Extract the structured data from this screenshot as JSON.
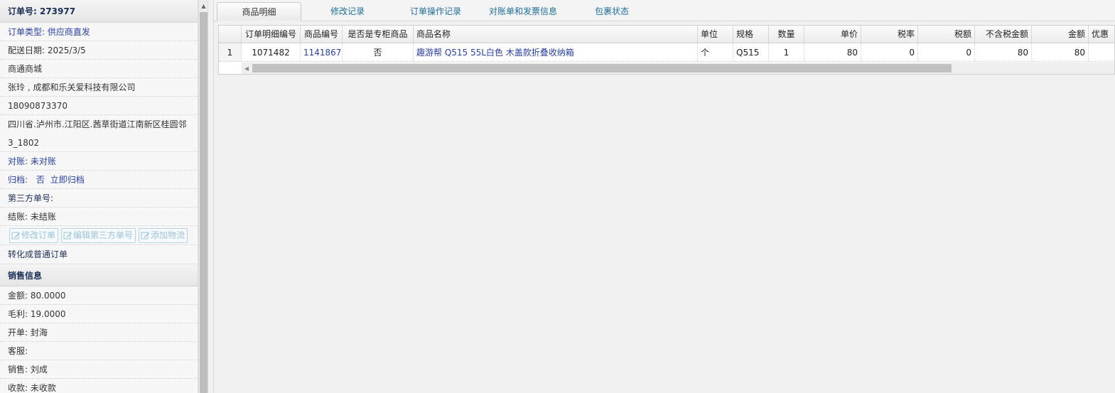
{
  "order": {
    "number_label": "订单号: 273977",
    "type": "订单类型: 供应商直发",
    "delivery_date": "配送日期: 2025/3/5",
    "store": "商通商城",
    "customer": "张玲 , 成都和乐关爱科技有限公司",
    "phone": "18090873370",
    "address_line1": "四川省.泸州市.江阳区.茜草街道江南新区桂圆邻",
    "address_line2": "3_1802",
    "reconciliation": "对账: 未对账",
    "archive_prefix": "归档:",
    "archive_status": "否",
    "archive_link": "立即归档",
    "third_party_no": "第三方单号:",
    "settlement": "结账: 未结账",
    "buttons": {
      "edit_order": "修改订单",
      "edit_third_party": "编辑第三方单号",
      "add_logistics": "添加物流"
    },
    "convert_link": "转化成普通订单"
  },
  "sales": {
    "title": "销售信息",
    "amount": "金额: 80.0000",
    "gross_profit": "毛利: 19.0000",
    "opened_by": "开单: 封海",
    "service": "客服:",
    "salesperson": "销售: 刘成",
    "payment": "收款: 未收款"
  },
  "tabs": [
    {
      "label": "商品明细",
      "active": true
    },
    {
      "label": "修改记录",
      "active": false
    },
    {
      "label": "订单操作记录",
      "active": false
    },
    {
      "label": "对账单和发票信息",
      "active": false
    },
    {
      "label": "包裹状态",
      "active": false
    }
  ],
  "grid": {
    "columns": [
      "订单明细编号",
      "商品编号",
      "是否是专柜商品",
      "商品名称",
      "单位",
      "规格",
      "数量",
      "单价",
      "税率",
      "税额",
      "不含税金额",
      "金额",
      "优惠"
    ],
    "rows": [
      {
        "index": "1",
        "detail_no": "1071482",
        "product_no": "1141867",
        "is_counter": "否",
        "name": "趣游帮 Q515 55L白色 木盖款折叠收纳箱",
        "unit": "个",
        "spec": "Q515",
        "qty": "1",
        "price": "80",
        "tax_rate": "0",
        "tax": "0",
        "amount_ex_tax": "80",
        "amount": "80",
        "discount": ""
      }
    ]
  },
  "colors": {
    "link_blue": "#2a40a3",
    "tab_text": "#1e6f99",
    "section_title": "#1a2f55",
    "disabled_button": "#9dc3d7"
  },
  "icons": {
    "edit": "edit-icon",
    "scroll_up": "arrow-up-icon",
    "scroll_left": "arrow-left-icon"
  }
}
